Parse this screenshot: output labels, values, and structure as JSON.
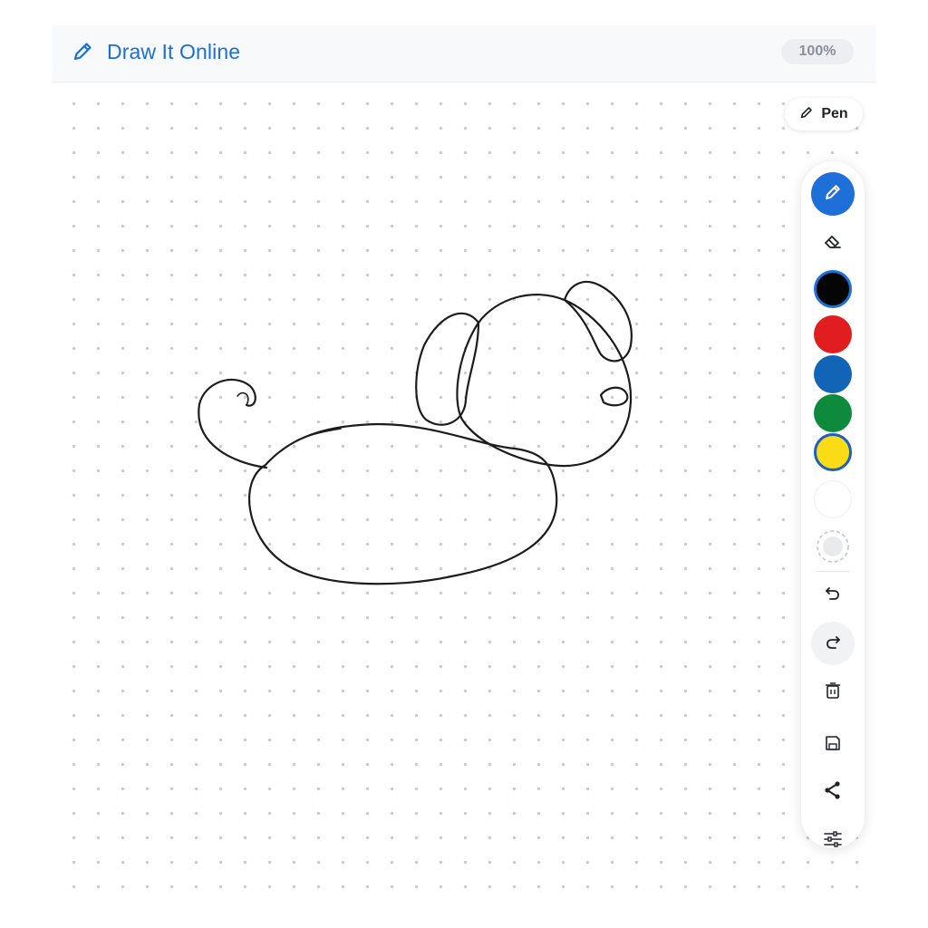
{
  "header": {
    "title": "Draw It Online",
    "zoom": "100%"
  },
  "tool_chip": {
    "label": "Pen"
  },
  "toolbar": {
    "tools": [
      "pen-icon",
      "eraser-icon"
    ],
    "selected_tool": "pen",
    "colors": [
      "#050505",
      "#e11d20",
      "#1264b6",
      "#0e8a3c",
      "#fadc16",
      "#ffffff"
    ],
    "selected_color": "#050505",
    "actions": [
      "brush-size-icon",
      "undo-icon",
      "redo-icon",
      "delete-icon",
      "save-icon",
      "share-icon",
      "settings-icon"
    ]
  },
  "colors": {
    "accent": "#1f6fd9",
    "title": "#1a6fd6",
    "stroke": "#1c1c1c"
  }
}
